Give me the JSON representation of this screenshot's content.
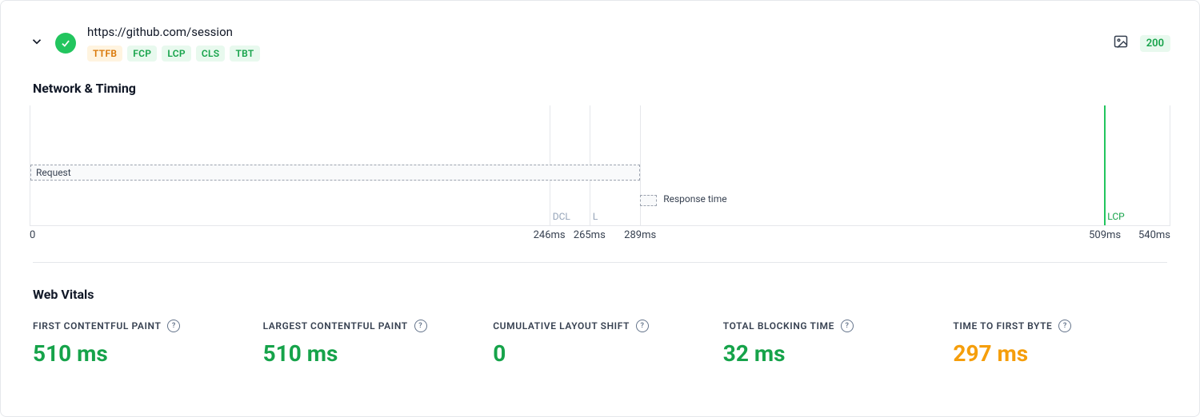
{
  "header": {
    "url": "https://github.com/session",
    "status_ok": true,
    "http_code": "200",
    "badges": [
      {
        "label": "TTFB",
        "tone": "orange"
      },
      {
        "label": "FCP",
        "tone": "green"
      },
      {
        "label": "LCP",
        "tone": "green"
      },
      {
        "label": "CLS",
        "tone": "green"
      },
      {
        "label": "TBT",
        "tone": "green"
      }
    ]
  },
  "sections": {
    "network_timing_title": "Network & Timing",
    "web_vitals_title": "Web Vitals"
  },
  "chart_data": {
    "type": "timeline",
    "title": "Network & Timing",
    "xlabel": "",
    "ylabel": "",
    "xlim": [
      0,
      540
    ],
    "x_unit": "ms",
    "ticks_ms": [
      0,
      246,
      265,
      289,
      509,
      540
    ],
    "tick_labels": [
      "0",
      "246ms",
      "265ms",
      "289ms",
      "509ms",
      "540ms"
    ],
    "bars": [
      {
        "name": "Request",
        "start_ms": 0,
        "end_ms": 289,
        "row": 0
      },
      {
        "name": "Response time",
        "start_ms": 289,
        "end_ms": 297,
        "row": 1
      }
    ],
    "markers": [
      {
        "label": "DCL",
        "at_ms": 246,
        "color": "muted"
      },
      {
        "label": "L",
        "at_ms": 265,
        "color": "muted"
      },
      {
        "label": "LCP",
        "at_ms": 509,
        "color": "green"
      }
    ]
  },
  "vitals": [
    {
      "label": "FIRST CONTENTFUL PAINT",
      "value": "510 ms",
      "tone": "green"
    },
    {
      "label": "LARGEST CONTENTFUL PAINT",
      "value": "510 ms",
      "tone": "green"
    },
    {
      "label": "CUMULATIVE LAYOUT SHIFT",
      "value": "0",
      "tone": "green"
    },
    {
      "label": "TOTAL BLOCKING TIME",
      "value": "32 ms",
      "tone": "green"
    },
    {
      "label": "TIME TO FIRST BYTE",
      "value": "297 ms",
      "tone": "orange"
    }
  ]
}
